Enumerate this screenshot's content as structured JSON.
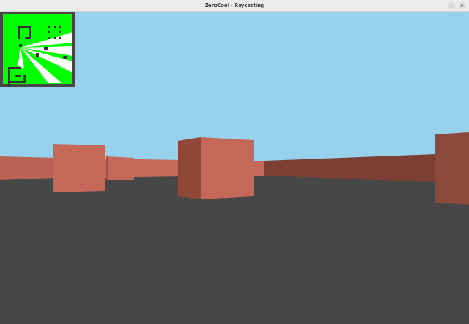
{
  "window": {
    "title": "ZeroCool - Raycasting",
    "buttons": [
      {
        "name": "minimize",
        "glyph": "–"
      },
      {
        "name": "close",
        "glyph": "×"
      }
    ]
  },
  "scene": {
    "sky_color": "#97d1ec",
    "floor_color": "#474747",
    "wall_light": "#c4695a",
    "wall_dark": "#7c3f33"
  },
  "minimap": {
    "background": "#00ff00",
    "frame": "#474747",
    "ray_color": "#ffffff",
    "block_color": "#333333"
  }
}
